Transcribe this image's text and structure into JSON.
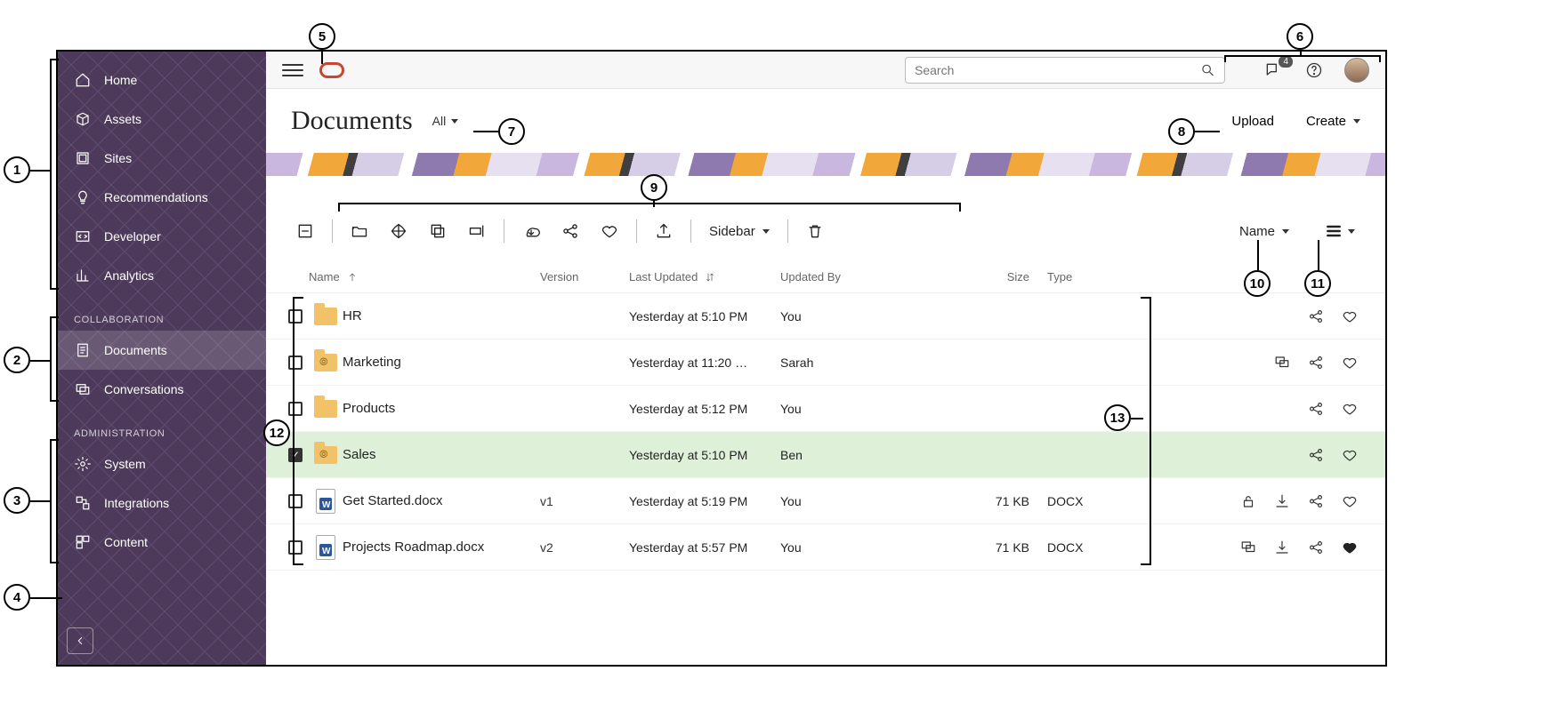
{
  "sidebar": {
    "groups": [
      {
        "label": null,
        "items": [
          {
            "icon": "home",
            "label": "Home"
          },
          {
            "icon": "assets",
            "label": "Assets"
          },
          {
            "icon": "sites",
            "label": "Sites"
          },
          {
            "icon": "bulb",
            "label": "Recommendations"
          },
          {
            "icon": "dev",
            "label": "Developer"
          },
          {
            "icon": "analytics",
            "label": "Analytics"
          }
        ]
      },
      {
        "label": "COLLABORATION",
        "items": [
          {
            "icon": "documents",
            "label": "Documents",
            "selected": true
          },
          {
            "icon": "conversations",
            "label": "Conversations"
          }
        ]
      },
      {
        "label": "ADMINISTRATION",
        "items": [
          {
            "icon": "system",
            "label": "System"
          },
          {
            "icon": "integrations",
            "label": "Integrations"
          },
          {
            "icon": "content",
            "label": "Content"
          }
        ]
      }
    ]
  },
  "topbar": {
    "search_placeholder": "Search",
    "notification_count": "4"
  },
  "page": {
    "title": "Documents",
    "filter_label": "All",
    "upload_label": "Upload",
    "create_label": "Create"
  },
  "toolbar": {
    "sidebar_label": "Sidebar",
    "sort_label": "Name"
  },
  "columns": {
    "name": "Name",
    "version": "Version",
    "last_updated": "Last Updated",
    "updated_by": "Updated By",
    "size": "Size",
    "type": "Type"
  },
  "rows": [
    {
      "kind": "folder",
      "shared": false,
      "name": "HR",
      "version": "",
      "updated": "Yesterday at 5:10 PM",
      "by": "You",
      "size": "",
      "type": "",
      "selected": false,
      "actions": [
        "share",
        "fav"
      ]
    },
    {
      "kind": "folder",
      "shared": true,
      "name": "Marketing",
      "version": "",
      "updated": "Yesterday at 11:20 …",
      "by": "Sarah",
      "size": "",
      "type": "",
      "selected": false,
      "actions": [
        "comment",
        "share",
        "fav"
      ]
    },
    {
      "kind": "folder",
      "shared": false,
      "name": "Products",
      "version": "",
      "updated": "Yesterday at 5:12 PM",
      "by": "You",
      "size": "",
      "type": "",
      "selected": false,
      "actions": [
        "share",
        "fav"
      ]
    },
    {
      "kind": "folder",
      "shared": true,
      "name": "Sales",
      "version": "",
      "updated": "Yesterday at 5:10 PM",
      "by": "Ben",
      "size": "",
      "type": "",
      "selected": true,
      "actions": [
        "share",
        "fav"
      ]
    },
    {
      "kind": "docx",
      "shared": false,
      "name": "Get Started.docx",
      "version": "v1",
      "updated": "Yesterday at 5:19 PM",
      "by": "You",
      "size": "71 KB",
      "type": "DOCX",
      "selected": false,
      "actions": [
        "lock",
        "download",
        "share",
        "fav"
      ]
    },
    {
      "kind": "docx",
      "shared": false,
      "name": "Projects Roadmap.docx",
      "version": "v2",
      "updated": "Yesterday at 5:57 PM",
      "by": "You",
      "size": "71 KB",
      "type": "DOCX",
      "selected": false,
      "actions": [
        "comment",
        "download",
        "share",
        "fav-filled"
      ]
    }
  ],
  "annotations": {
    "1": "1",
    "2": "2",
    "3": "3",
    "4": "4",
    "5": "5",
    "6": "6",
    "7": "7",
    "8": "8",
    "9": "9",
    "10": "10",
    "11": "11",
    "12": "12",
    "13": "13"
  }
}
